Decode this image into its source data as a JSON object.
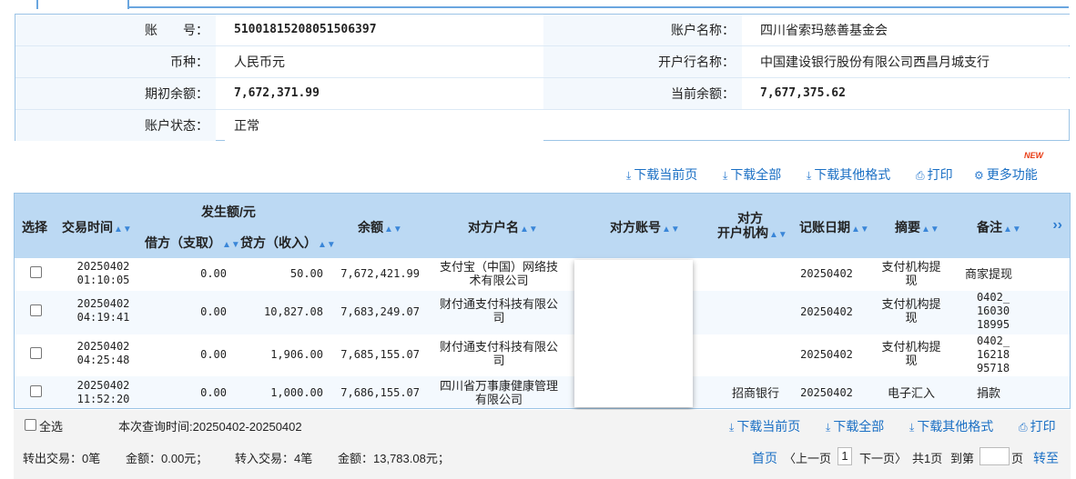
{
  "account": {
    "account_no_label": "账　　号：",
    "account_no": "51001815208051506397",
    "account_name_label": "账户名称：",
    "account_name": "四川省索玛慈善基金会",
    "currency_label": "币种：",
    "currency": "人民币元",
    "bank_label": "开户行名称：",
    "bank": "中国建设银行股份有限公司西昌月城支行",
    "opening_balance_label": "期初余额：",
    "opening_balance": "7,672,371.99",
    "current_balance_label": "当前余额：",
    "current_balance": "7,677,375.62",
    "status_label": "账户状态：",
    "status": "正常"
  },
  "toolbar": {
    "download_page": "下载当前页",
    "download_all": "下载全部",
    "download_other": "下载其他格式",
    "print": "打印",
    "more": "更多功能",
    "new_badge": "NEW"
  },
  "table": {
    "headers": {
      "select": "选择",
      "time": "交易时间",
      "amount_group": "发生额/元",
      "debit": "借方（支取）",
      "credit": "贷方（收入）",
      "balance": "余额",
      "counter_name": "对方户名",
      "counter_account": "对方账号",
      "counter_bank_1": "对方",
      "counter_bank_2": "开户机构",
      "post_date": "记账日期",
      "summary": "摘要",
      "remark": "备注",
      "more": "››"
    },
    "rows": [
      {
        "time_1": "20250402",
        "time_2": "01:10:05",
        "debit": "0.00",
        "credit": "50.00",
        "balance": "7,672,421.99",
        "counter_name_1": "支付宝（中国）网络技",
        "counter_name_2": "术有限公司",
        "counter_bank": "",
        "post_date": "20250402",
        "summary_1": "支付机构提",
        "summary_2": "现",
        "remark_1": "商家提现",
        "remark_2": "",
        "remark_3": ""
      },
      {
        "time_1": "20250402",
        "time_2": "04:19:41",
        "debit": "0.00",
        "credit": "10,827.08",
        "balance": "7,683,249.07",
        "counter_name_1": "财付通支付科技有限公",
        "counter_name_2": "司",
        "counter_bank": "",
        "post_date": "20250402",
        "summary_1": "支付机构提",
        "summary_2": "现",
        "remark_1": "0402_",
        "remark_2": "16030",
        "remark_3": "18995"
      },
      {
        "time_1": "20250402",
        "time_2": "04:25:48",
        "debit": "0.00",
        "credit": "1,906.00",
        "balance": "7,685,155.07",
        "counter_name_1": "财付通支付科技有限公",
        "counter_name_2": "司",
        "counter_bank": "",
        "post_date": "20250402",
        "summary_1": "支付机构提",
        "summary_2": "现",
        "remark_1": "0402_",
        "remark_2": "16218",
        "remark_3": "95718"
      },
      {
        "time_1": "20250402",
        "time_2": "11:52:20",
        "debit": "0.00",
        "credit": "1,000.00",
        "balance": "7,686,155.07",
        "counter_name_1": "四川省万事康健康管理",
        "counter_name_2": "有限公司",
        "counter_bank": "招商银行",
        "post_date": "20250402",
        "summary_1": "电子汇入",
        "summary_2": "",
        "remark_1": "捐款",
        "remark_2": "",
        "remark_3": ""
      }
    ]
  },
  "footer": {
    "select_all": "全选",
    "query_time": "本次查询时间:20250402-20250402",
    "download_page": "下载当前页",
    "download_all": "下载全部",
    "download_other": "下载其他格式",
    "print": "打印",
    "out_count": "转出交易：0笔",
    "out_amount": "金额：0.00元；",
    "in_count": "转入交易：4笔",
    "in_amount": "金额：13,783.08元；",
    "first": "首页",
    "prev": "〈上一页",
    "page": "1",
    "next": "下一页〉",
    "total": "共1页",
    "goto_label": "到第",
    "goto_value": "",
    "page_suffix": "页",
    "goto_btn": "转至"
  },
  "colors": {
    "header_bg": "#bcd9f3",
    "link": "#1a6fc4",
    "border": "#9cc4e6",
    "badge": "#e83a12"
  }
}
